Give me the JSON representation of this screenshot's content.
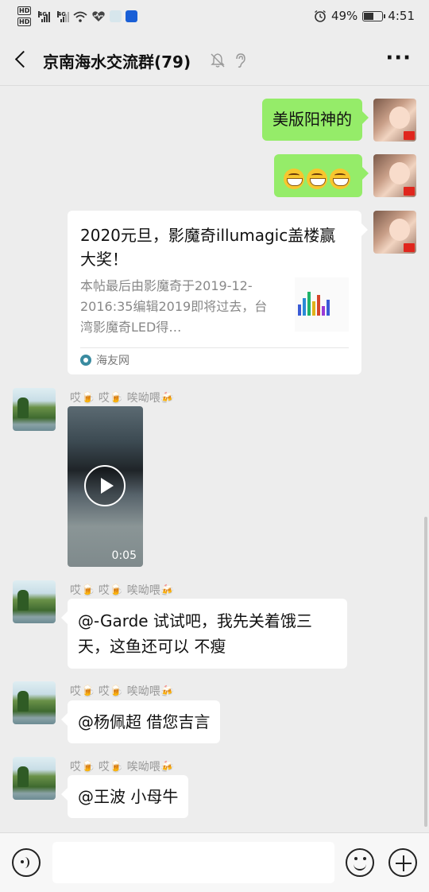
{
  "status_bar": {
    "hd1": "HD",
    "hd2": "HD",
    "net1": "4G",
    "net2": "4G",
    "battery_percent": "49%",
    "battery_level": 0.49,
    "time": "4:51"
  },
  "header": {
    "title": "京南海水交流群(79)",
    "more": "···"
  },
  "messages": {
    "m1": {
      "text": "美版阳神的"
    },
    "m2": {
      "emoji": "grinning-face-icon",
      "count": 3
    },
    "m3": {
      "title": "2020元旦，影魔奇illumagic盖楼赢大奖！",
      "desc": "本帖最后由影魔奇于2019-12-2016:35编辑2019即将过去，台湾影魔奇LED得…",
      "source": "海友网"
    },
    "sender_name": "哎🍺 哎🍺 唉呦喂🍻",
    "m4": {
      "duration": "0:05"
    },
    "m5": {
      "text": "@-Garde  试试吧，我先关着饿三天，这鱼还可以 不瘦"
    },
    "m6": {
      "text": "@杨佩超  借您吉言"
    },
    "m7": {
      "text": "@王波  小母牛"
    }
  },
  "input_bar": {
    "placeholder": ""
  },
  "colors": {
    "background": "#ededed",
    "self_bubble": "#95ec69",
    "other_bubble": "#ffffff"
  }
}
